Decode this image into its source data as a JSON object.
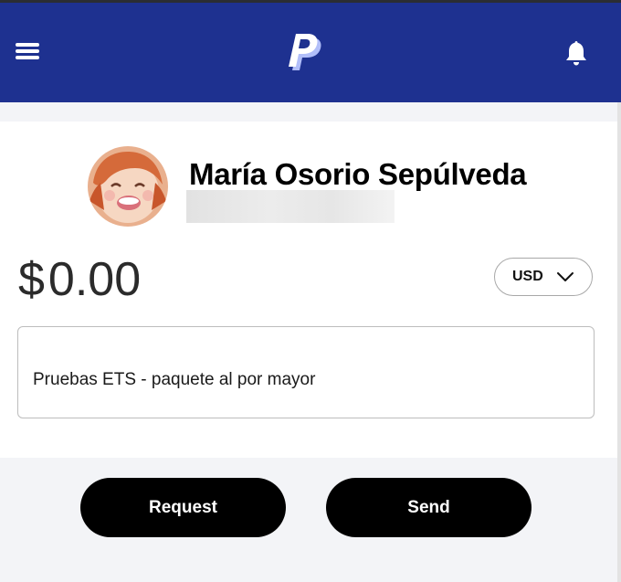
{
  "header": {
    "menu_icon": "hamburger-menu-icon",
    "logo_icon": "paypal-logo-icon",
    "notifications_icon": "bell-icon",
    "background_color": "#1e3190"
  },
  "recipient": {
    "name": "María Osorio Sepúlveda",
    "avatar_icon": "avatar-image"
  },
  "amount": {
    "symbol": "$",
    "value": "0.00"
  },
  "currency": {
    "selected": "USD",
    "icon": "chevron-down-icon"
  },
  "note": {
    "value": "Pruebas ETS - paquete al por mayor"
  },
  "actions": {
    "request_label": "Request",
    "send_label": "Send",
    "button_color": "#000000"
  }
}
